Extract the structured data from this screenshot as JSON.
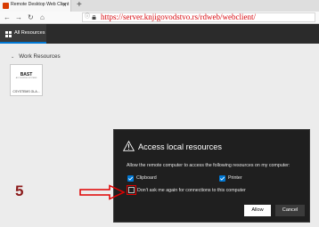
{
  "browser": {
    "tab_title": "Remote Desktop Web Client",
    "tab_close": "×",
    "new_tab": "+",
    "url": "https://server.knjigovodstvo.rs/rdweb/webclient/"
  },
  "app": {
    "tab_label": "All Resources"
  },
  "resources": {
    "section_title": "Work Resources",
    "tile_logo": "BAST",
    "tile_logo_sub": "ACCOUNTING SYSTEMS",
    "tile_label": "CSYSTEMS GLA..."
  },
  "dialog": {
    "title": "Access local resources",
    "message": "Allow the remote computer to access the following resources on my computer:",
    "clipboard_label": "Clipboard",
    "printer_label": "Printer",
    "dont_ask_label": "Don't ask me again for connections to this computer",
    "allow_label": "Allow",
    "cancel_label": "Cancel",
    "clipboard_checked": true,
    "printer_checked": true,
    "dont_ask_checked": false
  },
  "annotation": {
    "step_number": "5",
    "highlight_color": "#e00000"
  },
  "colors": {
    "accent": "#0078d4",
    "dialog_bg": "#1f1f1f",
    "url_color": "#d8090f"
  }
}
